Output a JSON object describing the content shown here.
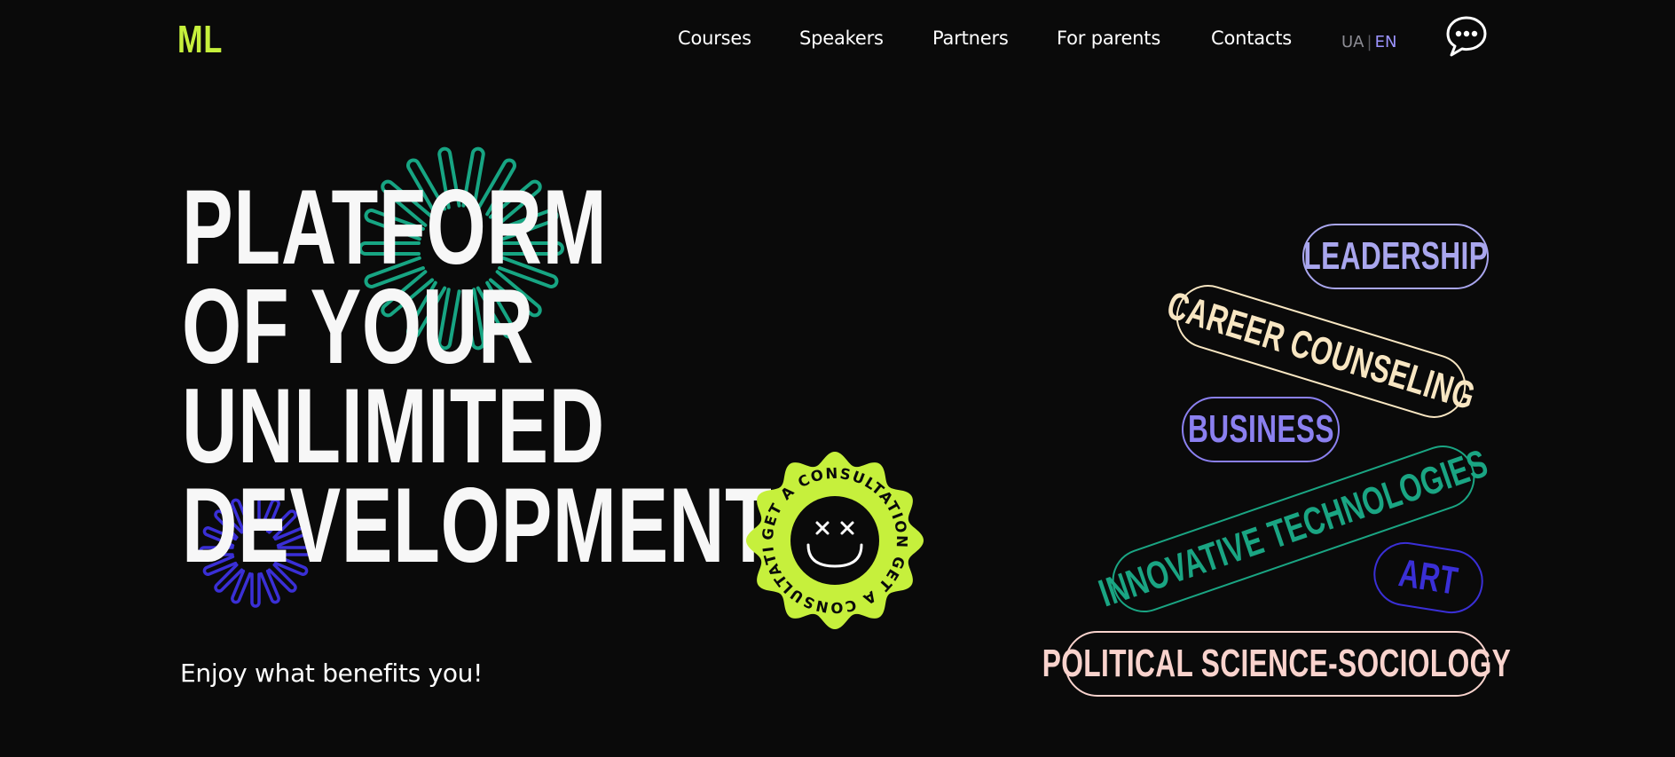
{
  "header": {
    "logo": "ML",
    "nav": [
      {
        "label": "Courses"
      },
      {
        "label": "Speakers"
      },
      {
        "label": "Partners"
      },
      {
        "label": "For parents"
      },
      {
        "label": "Contacts"
      }
    ],
    "lang": {
      "ua": "UA",
      "separator": "|",
      "en": "EN",
      "active": "EN"
    },
    "chat_icon": "chat-bubble-dots-icon"
  },
  "hero": {
    "title_lines": [
      "PLATFORM",
      "OF YOUR",
      "UNLIMITED",
      "DEVELOPMENT"
    ],
    "subtitle": "Enjoy what benefits you!"
  },
  "badge": {
    "text": "GET A CONSULTATION GET A CONSULTATION",
    "icon": "dizzy-smiley-face-icon",
    "color": "#c6f03c"
  },
  "tags": [
    {
      "label": "LEADERSHIP",
      "color": "#a9a6ee"
    },
    {
      "label": "CAREER COUNSELING",
      "color": "#f8e6c2"
    },
    {
      "label": "BUSINESS",
      "color": "#8b80f0"
    },
    {
      "label": "INNOVATIVE TECHNOLOGIES",
      "color": "#1aa583"
    },
    {
      "label": "ART",
      "color": "#3a2fd6"
    },
    {
      "label": "POLITICAL SCIENCE-SOCIOLOGY",
      "color": "#f9d3cd"
    }
  ],
  "colors": {
    "background": "#0a0a0a",
    "accent": "#c6f03c",
    "green_burst": "#17a583",
    "blue_burst": "#3a2fd6"
  }
}
